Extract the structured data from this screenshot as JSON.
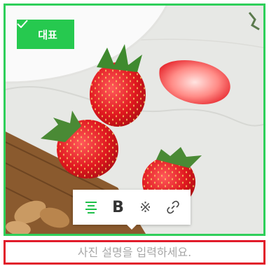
{
  "photo": {
    "alt": "",
    "representative_badge": {
      "icon": "check-icon",
      "label": "대표"
    }
  },
  "toolbar": {
    "buttons": [
      {
        "name": "align",
        "icon": "align-center-icon"
      },
      {
        "name": "bold",
        "label": "B"
      },
      {
        "name": "special-char",
        "label": "※"
      },
      {
        "name": "link",
        "icon": "link-icon"
      }
    ]
  },
  "caption": {
    "placeholder": "사진 설명을 입력하세요.",
    "value": ""
  },
  "colors": {
    "selection_border": "#2fcf5a",
    "badge": "#26c94f",
    "align_active": "#1fc04a",
    "caption_border": "#e11b2a"
  }
}
